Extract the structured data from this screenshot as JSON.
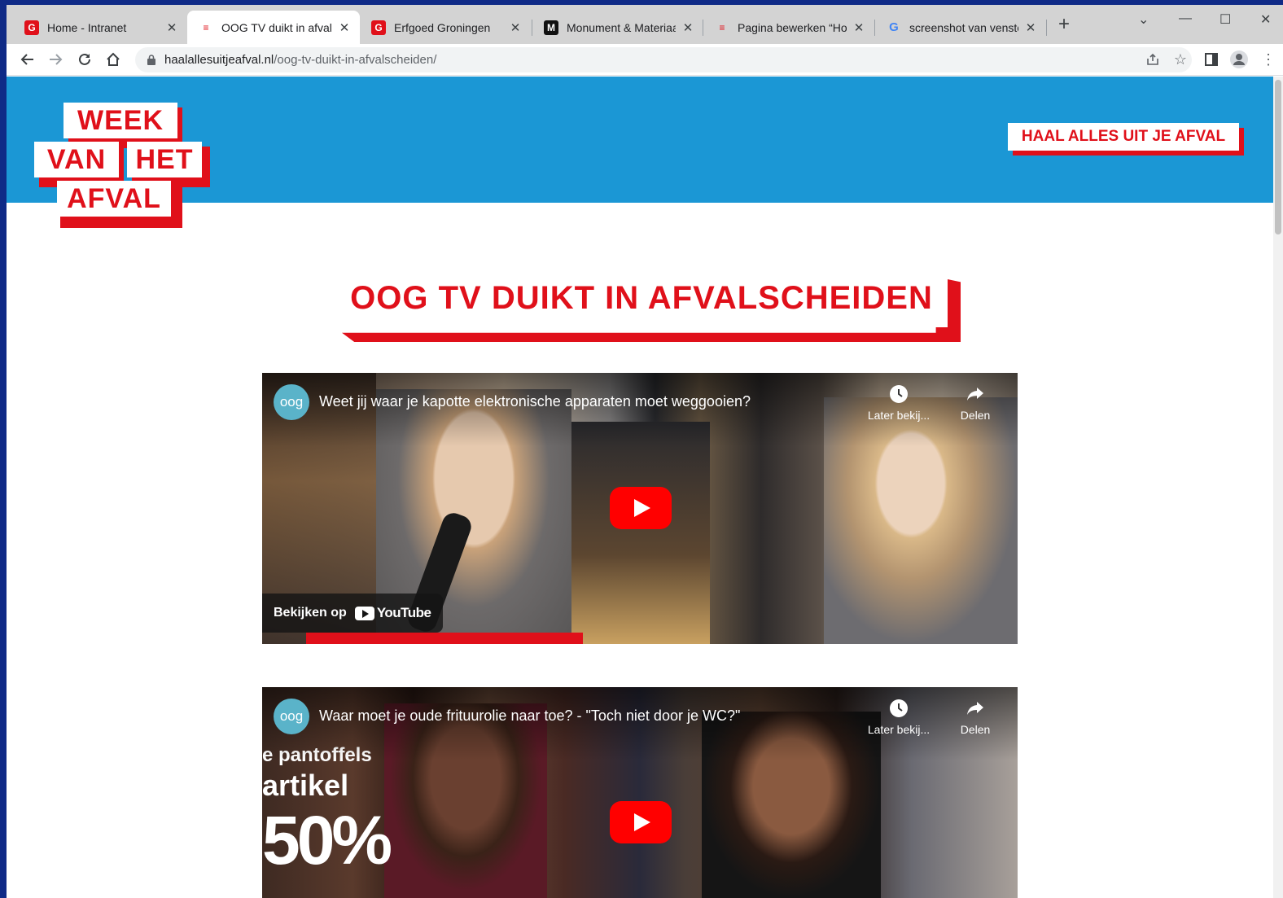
{
  "browser": {
    "tabs": [
      {
        "title": "Home - Intranet",
        "favicon": "G",
        "favicon_color": "#e0101a"
      },
      {
        "title": "OOG TV duikt in afvalsc",
        "favicon": "≡",
        "favicon_color": "#e0101a",
        "active": true
      },
      {
        "title": "Erfgoed Groningen",
        "favicon": "G",
        "favicon_color": "#e0101a"
      },
      {
        "title": "Monument & Materiaal",
        "favicon": "M",
        "favicon_color": "#111111"
      },
      {
        "title": "Pagina bewerken “Hom",
        "favicon": "≡",
        "favicon_color": "#e0101a"
      },
      {
        "title": "screenshot van venster",
        "favicon": "G",
        "favicon_color": "#4285f4"
      }
    ],
    "new_tab": "+",
    "url_domain": "haalallesuitjeafval.nl",
    "url_path": "/oog-tv-duikt-in-afvalscheiden/"
  },
  "site": {
    "logo": {
      "line1": "WEEK",
      "line2a": "VAN",
      "line2b": "HET",
      "line3": "AFVAL"
    },
    "cta": "HAAL ALLES UIT JE AFVAL",
    "heading": "OOG TV DUIKT IN AFVALSCHEIDEN",
    "brand_red": "#e0101a",
    "brand_blue": "#1b97d5"
  },
  "videos": [
    {
      "channel": "oog",
      "title": "Weet jij waar je kapotte elektronische apparaten moet weggooien?",
      "watch_later": "Later bekij...",
      "share": "Delen",
      "watch_on": "Bekijken op",
      "youtube": "YouTube"
    },
    {
      "channel": "oog",
      "title": "Waar moet je oude frituurolie naar toe? - \"Toch niet door je WC?\"",
      "watch_later": "Later bekij...",
      "share": "Delen",
      "overlay_lines": [
        "e pantoffels",
        "artikel",
        "50%"
      ]
    }
  ]
}
